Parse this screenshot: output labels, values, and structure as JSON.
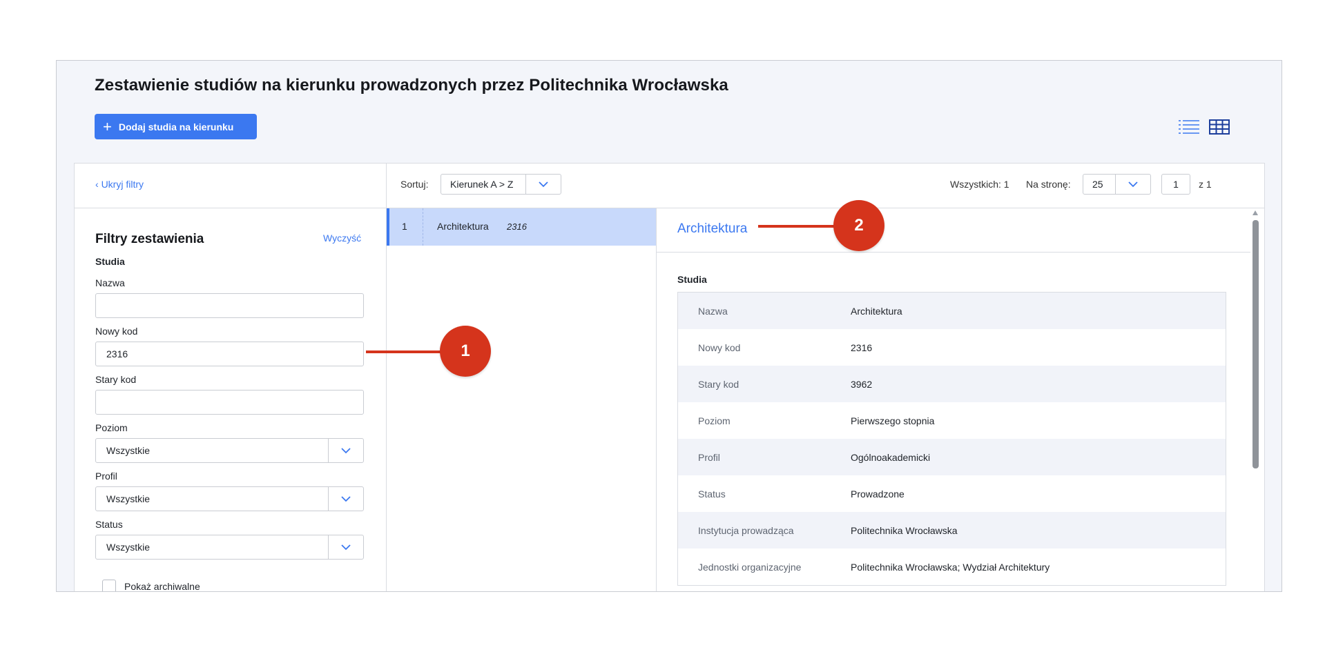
{
  "header": {
    "title": "Zestawienie studiów na kierunku prowadzonych przez Politechnika Wrocławska",
    "add_button_label": "Dodaj studia na kierunku",
    "view_list_icon": "list-view-icon",
    "view_table_icon": "table-view-icon"
  },
  "toolbar": {
    "hide_filters": "Ukryj filtry",
    "sort_label": "Sortuj:",
    "sort_value": "Kierunek A > Z",
    "total_label": "Wszystkich: 1",
    "per_page_label": "Na stronę:",
    "per_page_value": "25",
    "page_value": "1",
    "page_of": "z  1"
  },
  "filters": {
    "title": "Filtry zestawienia",
    "clear": "Wyczyść",
    "section": "Studia",
    "name_label": "Nazwa",
    "name_value": "",
    "new_code_label": "Nowy kod",
    "new_code_value": "2316",
    "old_code_label": "Stary kod",
    "old_code_value": "",
    "level_label": "Poziom",
    "level_value": "Wszystkie",
    "profile_label": "Profil",
    "profile_value": "Wszystkie",
    "status_label": "Status",
    "status_value": "Wszystkie",
    "show_archived": "Pokaż archiwalne"
  },
  "results": [
    {
      "num": "1",
      "name": "Architektura",
      "code": "2316"
    }
  ],
  "detail": {
    "title": "Architektura",
    "section": "Studia",
    "rows": [
      {
        "k": "Nazwa",
        "v": "Architektura"
      },
      {
        "k": "Nowy kod",
        "v": "2316"
      },
      {
        "k": "Stary kod",
        "v": "3962"
      },
      {
        "k": "Poziom",
        "v": "Pierwszego stopnia"
      },
      {
        "k": "Profil",
        "v": "Ogólnoakademicki"
      },
      {
        "k": "Status",
        "v": "Prowadzone"
      },
      {
        "k": "Instytucja prowadząca",
        "v": "Politechnika Wrocławska"
      },
      {
        "k": "Jednostki organizacyjne",
        "v": "Politechnika Wrocławska; Wydział Architektury"
      }
    ]
  },
  "callouts": [
    "1",
    "2"
  ],
  "colors": {
    "accent": "#3b78f0",
    "callout": "#d5341c",
    "selected_row": "#c8d9fb"
  }
}
